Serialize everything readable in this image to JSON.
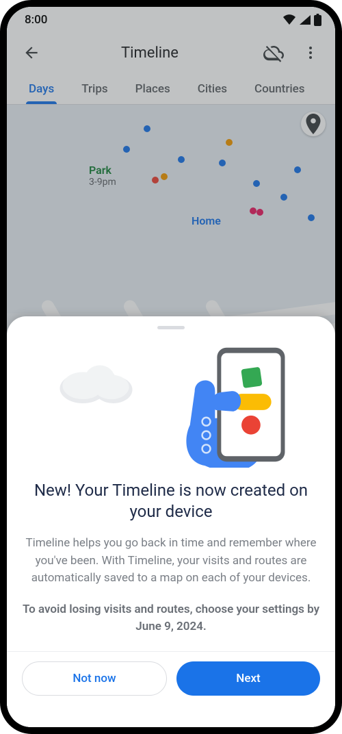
{
  "status": {
    "time": "8:00"
  },
  "header": {
    "title": "Timeline"
  },
  "tabs": {
    "items": [
      {
        "label": "Days"
      },
      {
        "label": "Trips"
      },
      {
        "label": "Places"
      },
      {
        "label": "Cities"
      },
      {
        "label": "Countries"
      }
    ],
    "active_index": 0
  },
  "map": {
    "park": {
      "name": "Park",
      "time": "3-9pm"
    },
    "home": {
      "name": "Home"
    }
  },
  "sheet": {
    "title": "New! Your Timeline is now created on your device",
    "body": "Timeline helps you go back in time and remember where you've been.  With Timeline, your visits and routes are automatically saved to a map on each of your devices.",
    "emphasis": "To avoid losing visits and routes, choose your settings by June 9, 2024.",
    "actions": {
      "secondary": "Not now",
      "primary": "Next"
    }
  }
}
